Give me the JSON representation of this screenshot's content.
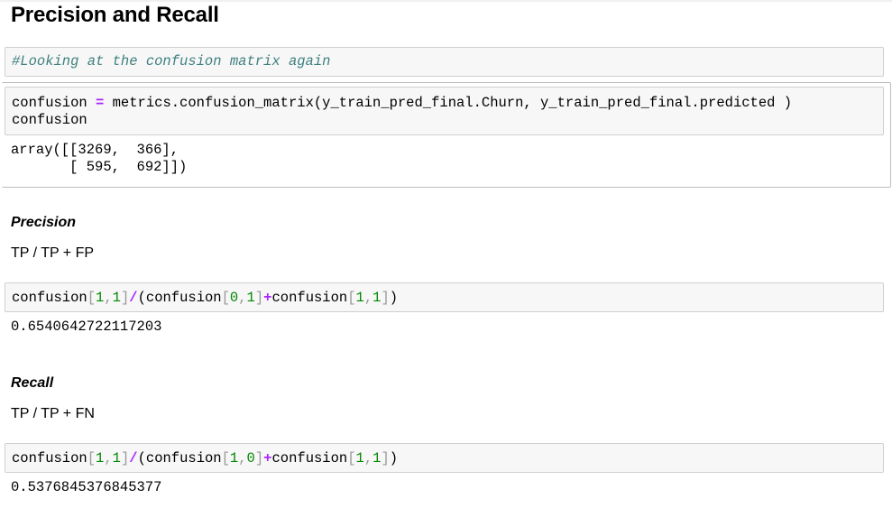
{
  "page_title": "Precision and Recall",
  "cells": {
    "comment_cell": {
      "text": "#Looking at the confusion matrix again"
    },
    "confusion_cell": {
      "line1_a": "confusion ",
      "line1_op": "=",
      "line1_b": " metrics.confusion_matrix(y_train_pred_final.Churn, y_train_pred_final.predicted )",
      "line2": "confusion",
      "output_line1": "array([[3269,  366],",
      "output_line2": "       [ 595,  692]])"
    },
    "precision_section": {
      "heading": "Precision",
      "formula": "TP / TP + FP",
      "code": {
        "t1": "confusion",
        "b1": "[",
        "n1": "1",
        "c1": ",",
        "n2": "1",
        "b2": "]",
        "op1": "/",
        "t2": "(confusion",
        "b3": "[",
        "n3": "0",
        "c2": ",",
        "n4": "1",
        "b4": "]",
        "op2": "+",
        "t3": "confusion",
        "b5": "[",
        "n5": "1",
        "c3": ",",
        "n6": "1",
        "b6": "]",
        "t4": ")"
      },
      "output": "0.6540642722117203"
    },
    "recall_section": {
      "heading": "Recall",
      "formula": "TP / TP + FN",
      "code": {
        "t1": "confusion",
        "b1": "[",
        "n1": "1",
        "c1": ",",
        "n2": "1",
        "b2": "]",
        "op1": "/",
        "t2": "(confusion",
        "b3": "[",
        "n3": "1",
        "c2": ",",
        "n4": "0",
        "b4": "]",
        "op2": "+",
        "t3": "confusion",
        "b5": "[",
        "n5": "1",
        "c3": ",",
        "n6": "1",
        "b6": "]",
        "t4": ")"
      },
      "output": "0.5376845376845377"
    }
  },
  "colors": {
    "comment": "#408080",
    "operator": "#aa22ff",
    "number": "#008800",
    "cell_background": "#f7f7f7",
    "cell_border": "#cfcfcf"
  }
}
